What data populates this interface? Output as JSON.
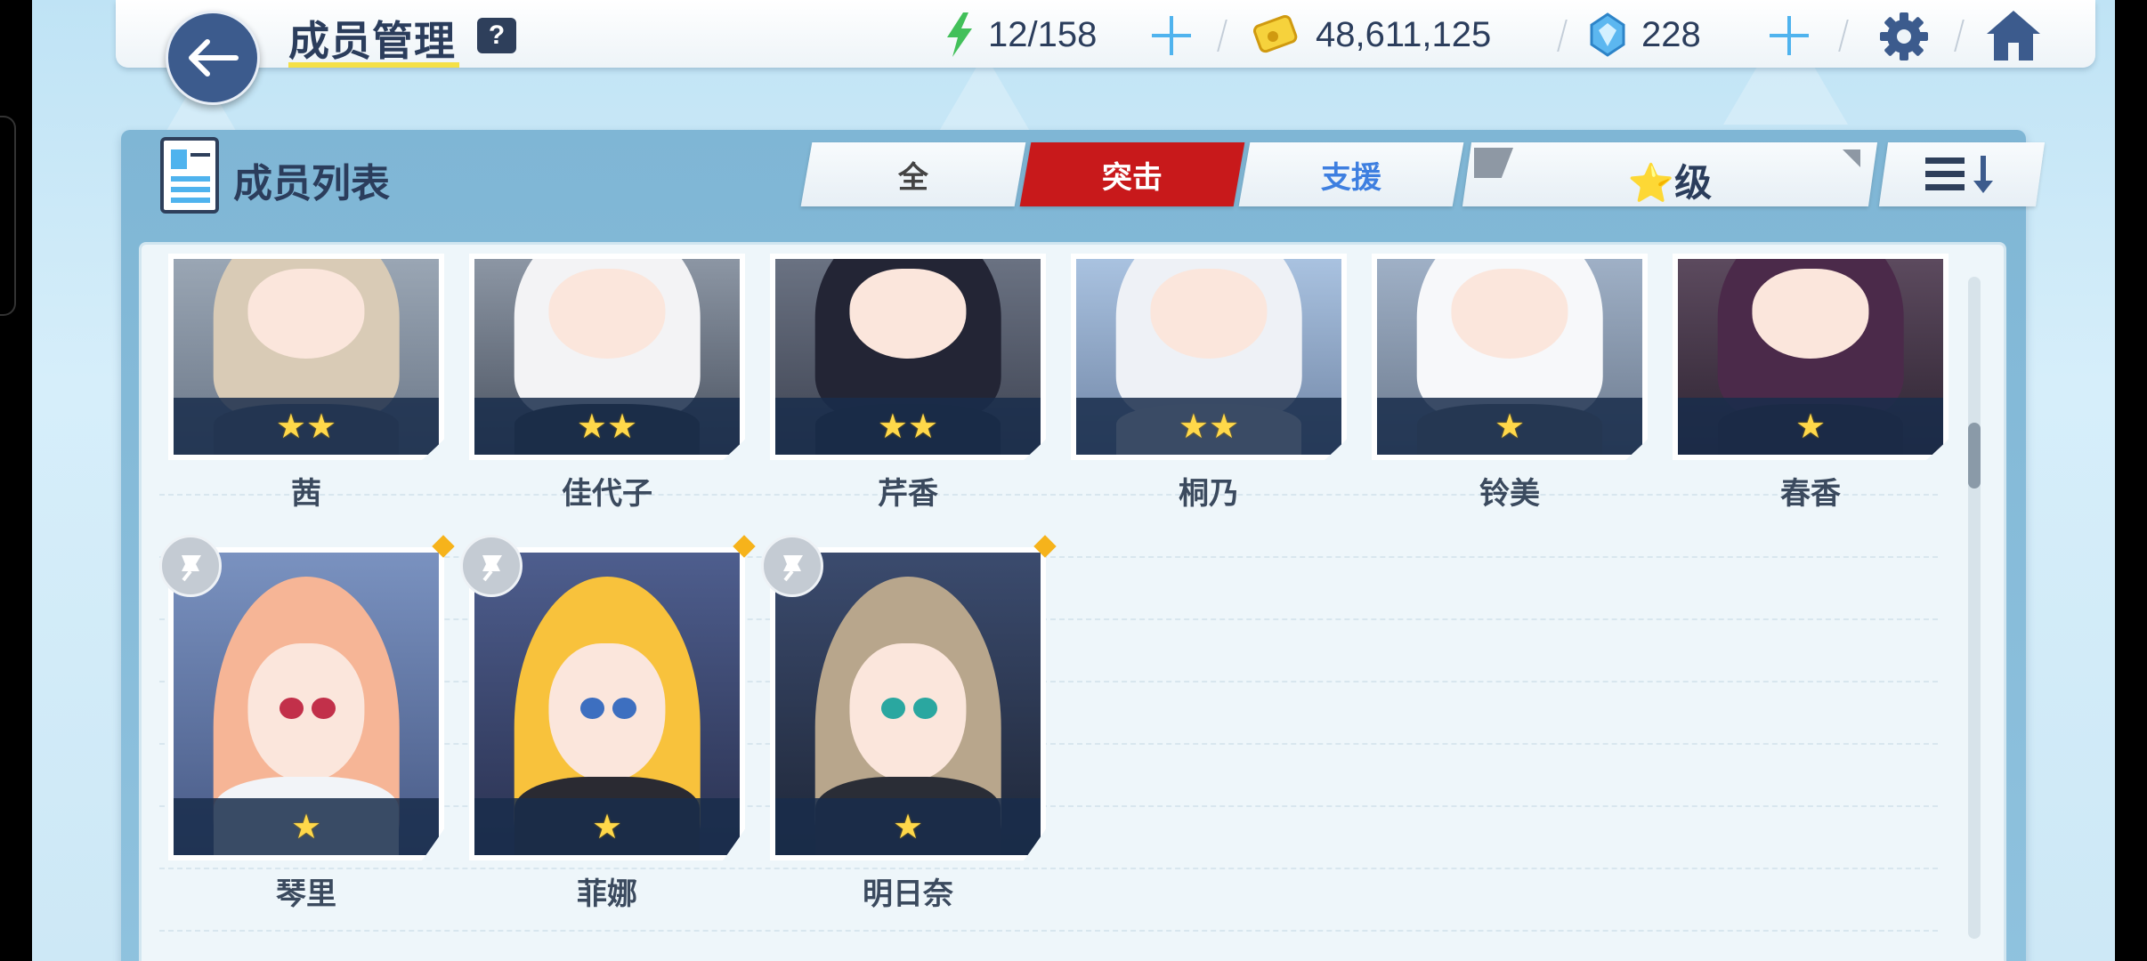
{
  "header": {
    "title": "成员管理",
    "help": "?",
    "ap": "12/158",
    "credits": "48,611,125",
    "gems": "228"
  },
  "panel": {
    "title": "成员列表",
    "tabs": [
      {
        "label": "全",
        "state": "normal"
      },
      {
        "label": "突击",
        "state": "active"
      },
      {
        "label": "支援",
        "state": "highlight"
      }
    ],
    "filter_label": "⭐级"
  },
  "members": [
    {
      "name": "茜",
      "stars": "★★"
    },
    {
      "name": "佳代子",
      "stars": "★★"
    },
    {
      "name": "芹香",
      "stars": "★★"
    },
    {
      "name": "桐乃",
      "stars": "★★"
    },
    {
      "name": "铃美",
      "stars": "★"
    },
    {
      "name": "春香",
      "stars": "★"
    },
    {
      "name": "琴里",
      "stars": "★"
    },
    {
      "name": "菲娜",
      "stars": "★"
    },
    {
      "name": "明日奈",
      "stars": "★"
    }
  ],
  "colors": {
    "accent_red": "#c8191b",
    "support_blue": "#3e7fe0",
    "navy": "#2b3d5c",
    "star": "#ffd84a"
  }
}
